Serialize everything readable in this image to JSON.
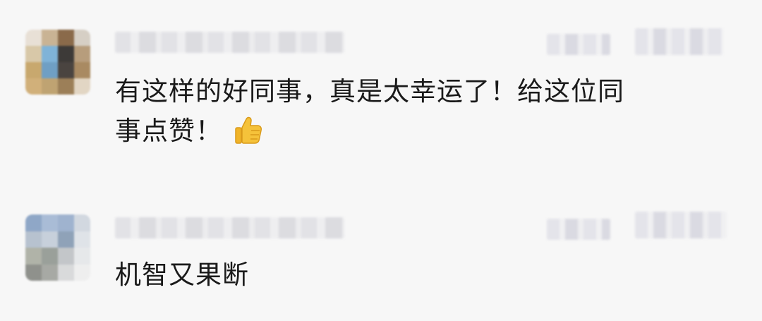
{
  "comments": [
    {
      "text_line1": "有这样的好同事，真是太幸运了！给这位同",
      "text_line2": "事点赞！",
      "emoji_icon": "thumbs-up-icon"
    },
    {
      "text": "机智又果断"
    }
  ]
}
